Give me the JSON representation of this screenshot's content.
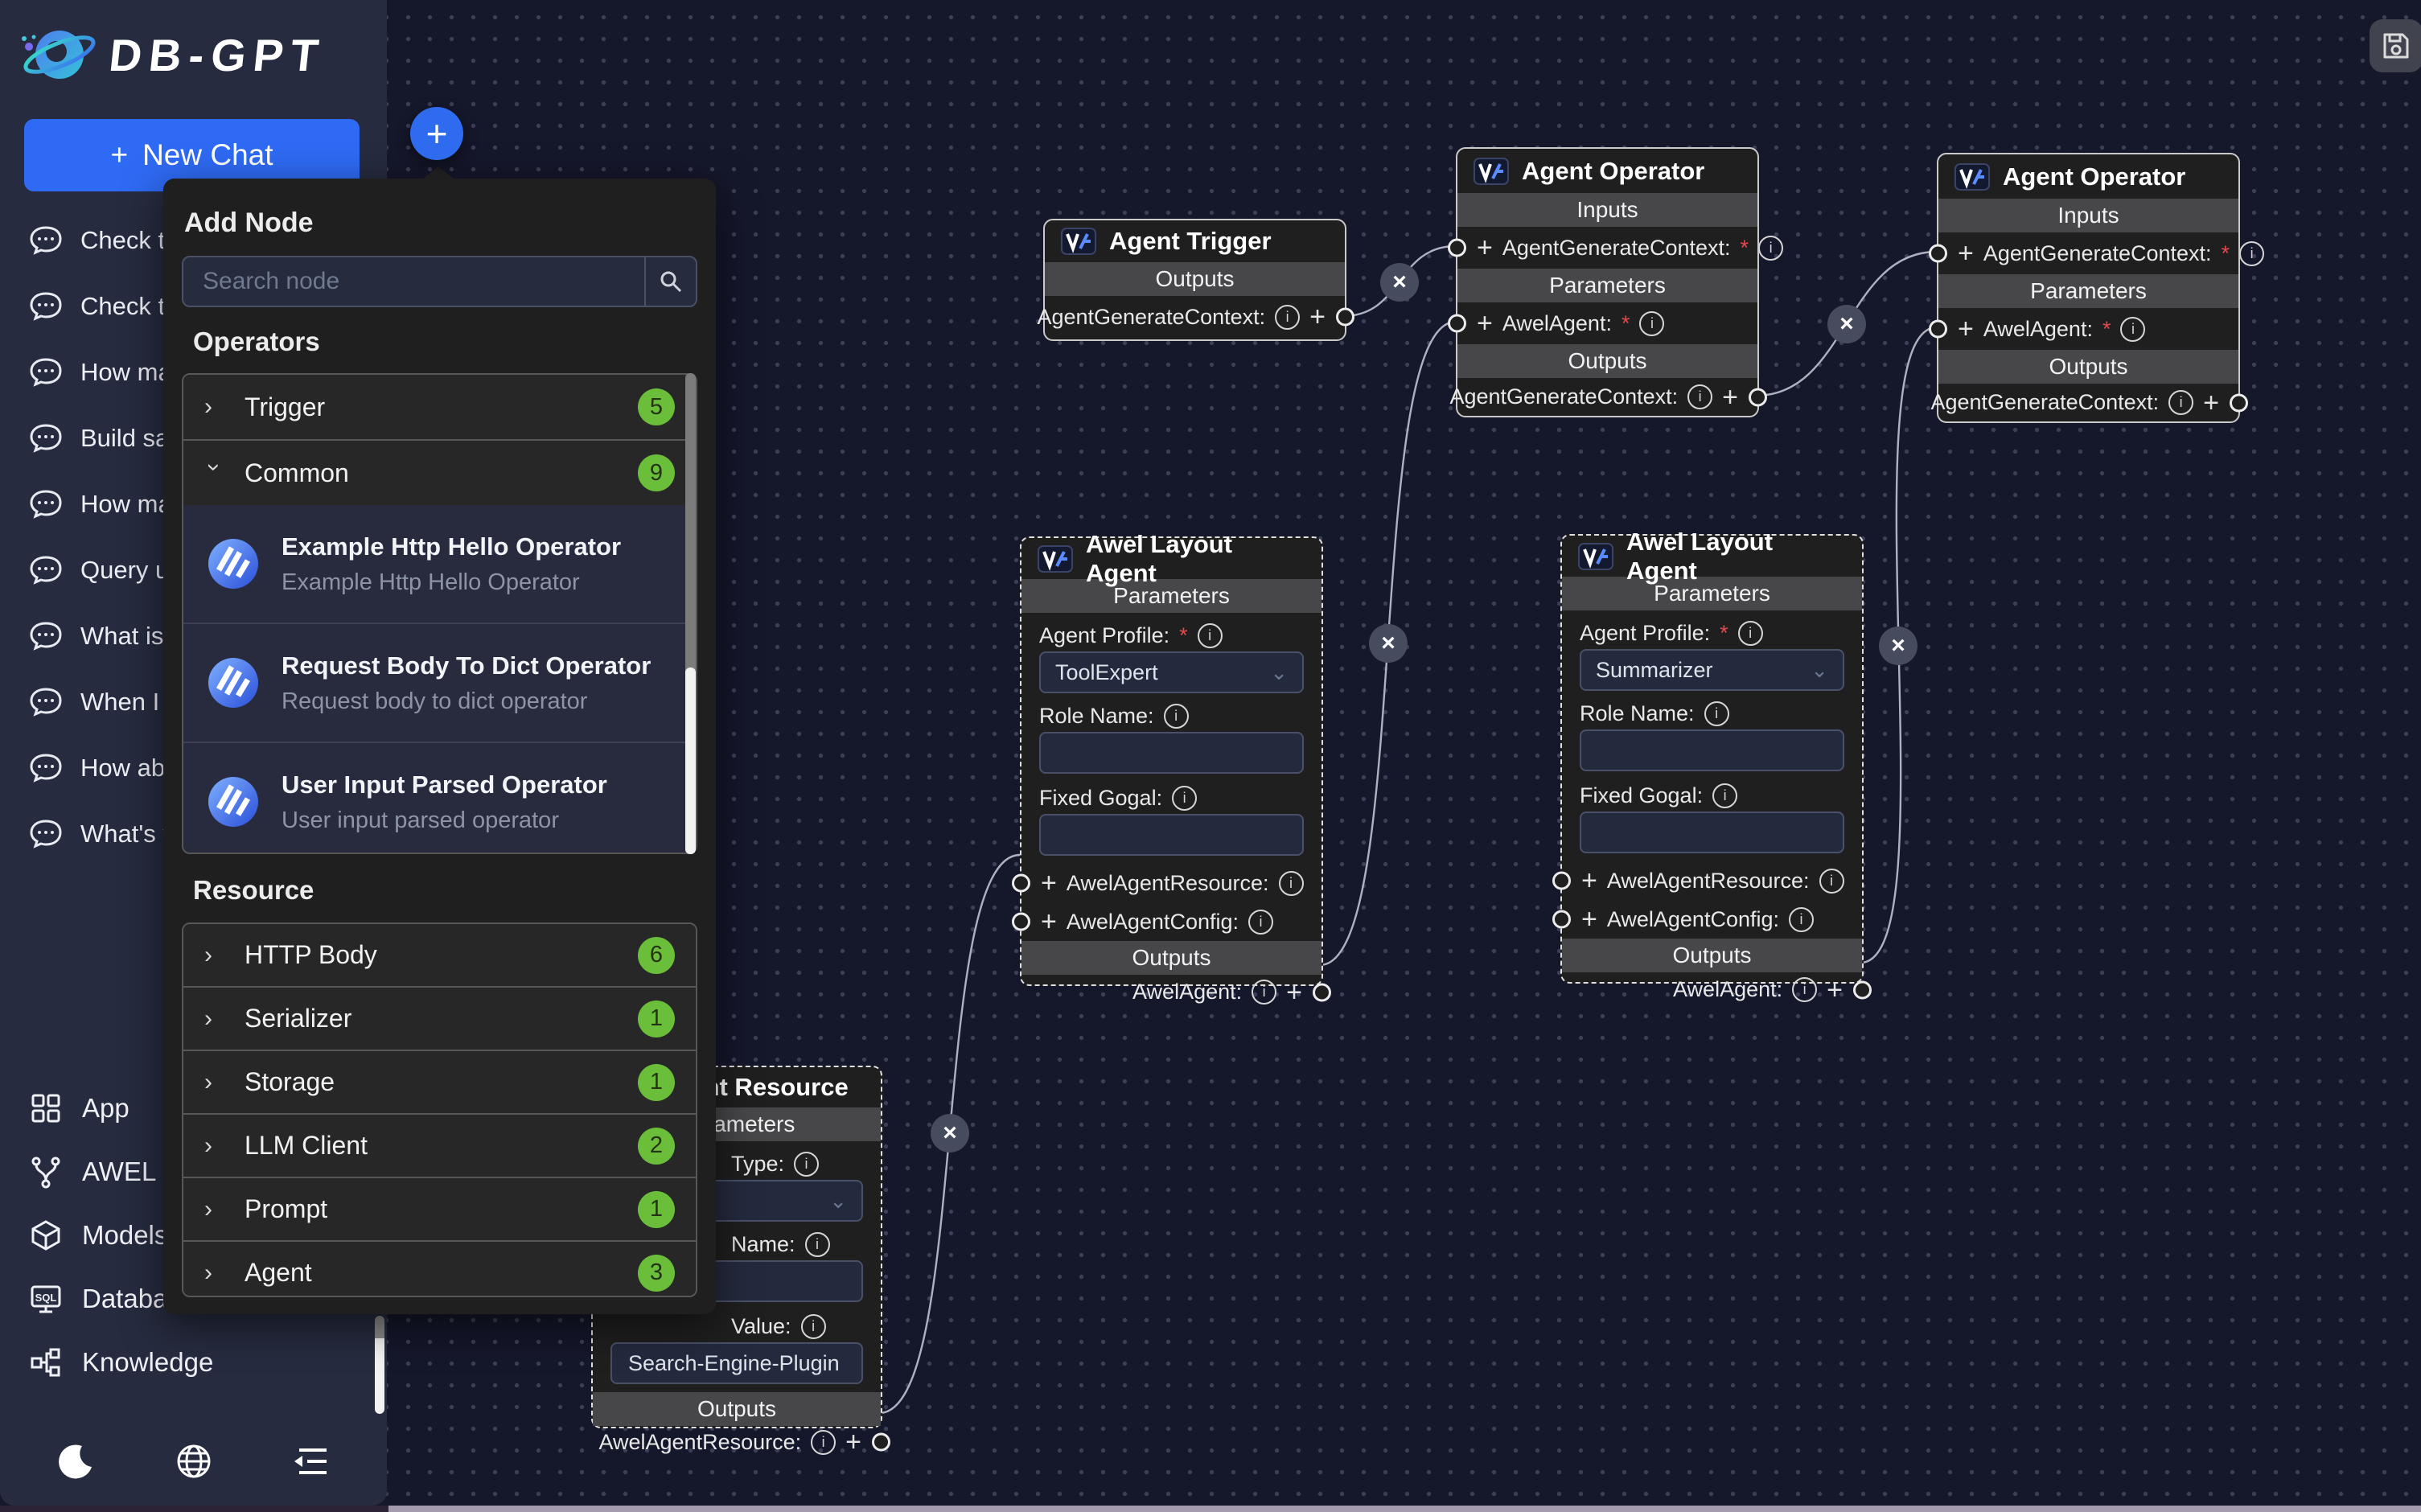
{
  "colors": {
    "accent_blue": "#2e6af3",
    "badge_green": "#6abe39",
    "canvas_bg": "#15172b",
    "sidebar_bg": "#262b3f",
    "panel_bg": "#1f1f1f",
    "node_bg": "#1f1f1f",
    "required_red": "#e5484d"
  },
  "sidebar": {
    "brand": "DB-GPT",
    "new_chat_label": "New Chat",
    "new_chat_plus": "+",
    "chats": [
      "Check the",
      "Check the",
      "How man",
      "Build sale",
      "How man",
      "Query us",
      "What is M",
      "When I ar",
      "How abou",
      "What's yo"
    ],
    "nav": [
      {
        "label": "App"
      },
      {
        "label": "AWEL Flow"
      },
      {
        "label": "Models"
      },
      {
        "label": "Database"
      },
      {
        "label": "Knowledge"
      }
    ]
  },
  "toolbar": {
    "add_node_button": "+"
  },
  "add_node_panel": {
    "title": "Add Node",
    "search_placeholder": "Search node",
    "operators_heading": "Operators",
    "operator_groups": [
      {
        "label": "Trigger",
        "count": "5"
      },
      {
        "label": "Common",
        "count": "9"
      }
    ],
    "common_items": [
      {
        "title": "Example Http Hello Operator",
        "desc": "Example Http Hello Operator"
      },
      {
        "title": "Request Body To Dict Operator",
        "desc": "Request body to dict operator"
      },
      {
        "title": "User Input Parsed Operator",
        "desc": "User input parsed operator"
      }
    ],
    "resource_heading": "Resource",
    "resource_groups": [
      {
        "label": "HTTP Body",
        "count": "6"
      },
      {
        "label": "Serializer",
        "count": "1"
      },
      {
        "label": "Storage",
        "count": "1"
      },
      {
        "label": "LLM Client",
        "count": "2"
      },
      {
        "label": "Prompt",
        "count": "1"
      },
      {
        "label": "Agent",
        "count": "3"
      }
    ]
  },
  "canvas": {
    "edge_delete_glyph": "×",
    "nodes": {
      "agent_trigger": {
        "title": "Agent Trigger",
        "outputs_heading": "Outputs",
        "output_label": "AgentGenerateContext:"
      },
      "agent_operator_a": {
        "title": "Agent Operator",
        "inputs_heading": "Inputs",
        "input_label": "AgentGenerateContext:",
        "parameters_heading": "Parameters",
        "param_label": "AwelAgent:",
        "outputs_heading": "Outputs",
        "output_label": "AgentGenerateContext:"
      },
      "agent_operator_b": {
        "title": "Agent Operator",
        "inputs_heading": "Inputs",
        "input_label": "AgentGenerateContext:",
        "parameters_heading": "Parameters",
        "param_label": "AwelAgent:",
        "outputs_heading": "Outputs",
        "output_label": "AgentGenerateContext:"
      },
      "awel_layout_agent_a": {
        "title": "Awel Layout Agent",
        "parameters_heading": "Parameters",
        "agent_profile_label": "Agent Profile:",
        "agent_profile_value": "ToolExpert",
        "role_name_label": "Role Name:",
        "fixed_gogal_label": "Fixed Gogal:",
        "resource_label": "AwelAgentResource:",
        "config_label": "AwelAgentConfig:",
        "outputs_heading": "Outputs",
        "output_label": "AwelAgent:"
      },
      "awel_layout_agent_b": {
        "title": "Awel Layout Agent",
        "parameters_heading": "Parameters",
        "agent_profile_label": "Agent Profile:",
        "agent_profile_value": "Summarizer",
        "role_name_label": "Role Name:",
        "fixed_gogal_label": "Fixed Gogal:",
        "resource_label": "AwelAgentResource:",
        "config_label": "AwelAgentConfig:",
        "outputs_heading": "Outputs",
        "output_label": "AwelAgent:"
      },
      "agent_resource": {
        "title": "Agent Resource",
        "parameters_heading": "Parameters",
        "type_label": "Type:",
        "name_label": "Name:",
        "value_label": "Value:",
        "value_text": "Search-Engine-Plugin",
        "outputs_heading": "Outputs",
        "output_label": "AwelAgentResource:"
      }
    }
  }
}
